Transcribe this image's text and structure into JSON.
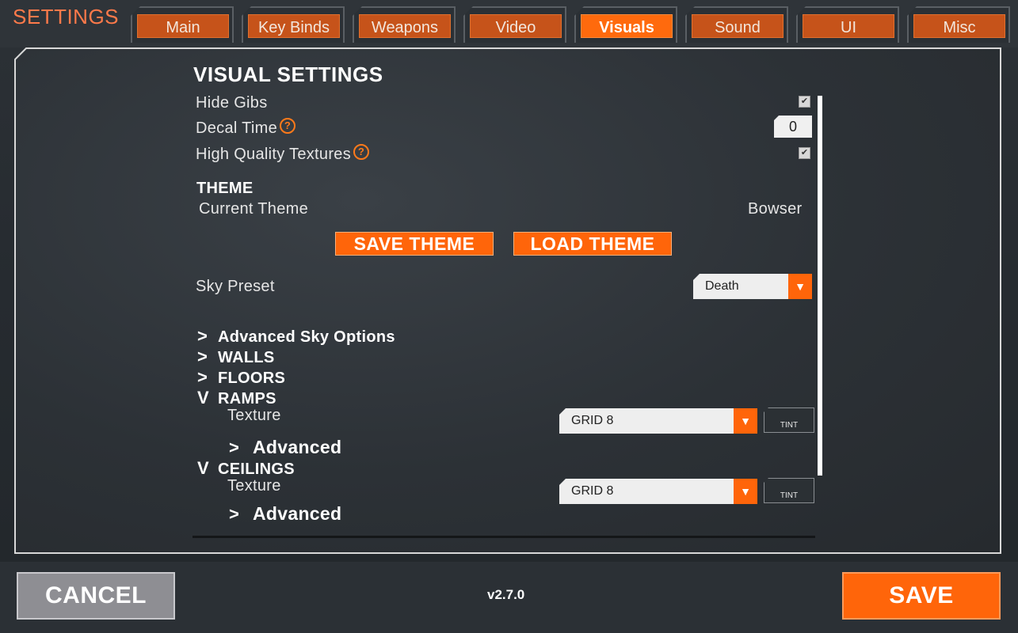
{
  "header": {
    "title": "SETTINGS",
    "tabs": [
      {
        "label": "Main",
        "active": false
      },
      {
        "label": "Key Binds",
        "active": false
      },
      {
        "label": "Weapons",
        "active": false
      },
      {
        "label": "Video",
        "active": false
      },
      {
        "label": "Visuals",
        "active": true
      },
      {
        "label": "Sound",
        "active": false
      },
      {
        "label": "UI",
        "active": false
      },
      {
        "label": "Misc",
        "active": false
      }
    ]
  },
  "visual_settings": {
    "heading": "VISUAL SETTINGS",
    "hide_gibs": {
      "label": "Hide Gibs",
      "checked": true
    },
    "decal_time": {
      "label": "Decal Time",
      "value": "0"
    },
    "high_quality_textures": {
      "label": "High Quality Textures",
      "checked": true
    },
    "help_glyph": "?"
  },
  "theme": {
    "heading": "THEME",
    "current_label": "Current Theme",
    "current_value": "Bowser",
    "save_button": "SAVE THEME",
    "load_button": "LOAD THEME"
  },
  "sky": {
    "label": "Sky Preset",
    "selected": "Death"
  },
  "sections": {
    "advanced_sky": "Advanced Sky Options",
    "walls": "WALLS",
    "floors": "FLOORS",
    "ramps": {
      "title": "RAMPS",
      "texture_label": "Texture",
      "texture_value": "GRID 8",
      "tint_label": "TINT",
      "advanced_label": "Advanced"
    },
    "ceilings": {
      "title": "CEILINGS",
      "texture_label": "Texture",
      "texture_value": "GRID 8",
      "tint_label": "TINT",
      "advanced_label": "Advanced"
    }
  },
  "footer": {
    "cancel_label": "CANCEL",
    "version": "v2.7.0",
    "save_label": "SAVE"
  },
  "colors": {
    "accent": "#ff650a",
    "title": "#ff7a4a",
    "panel_border": "#d8d8d8"
  },
  "icons": {
    "collapsed": "chevron-right-icon",
    "expanded": "chevron-down-icon",
    "dropdown": "caret-down-icon",
    "help": "question-circle-icon",
    "checkbox": "checkmark-icon"
  }
}
